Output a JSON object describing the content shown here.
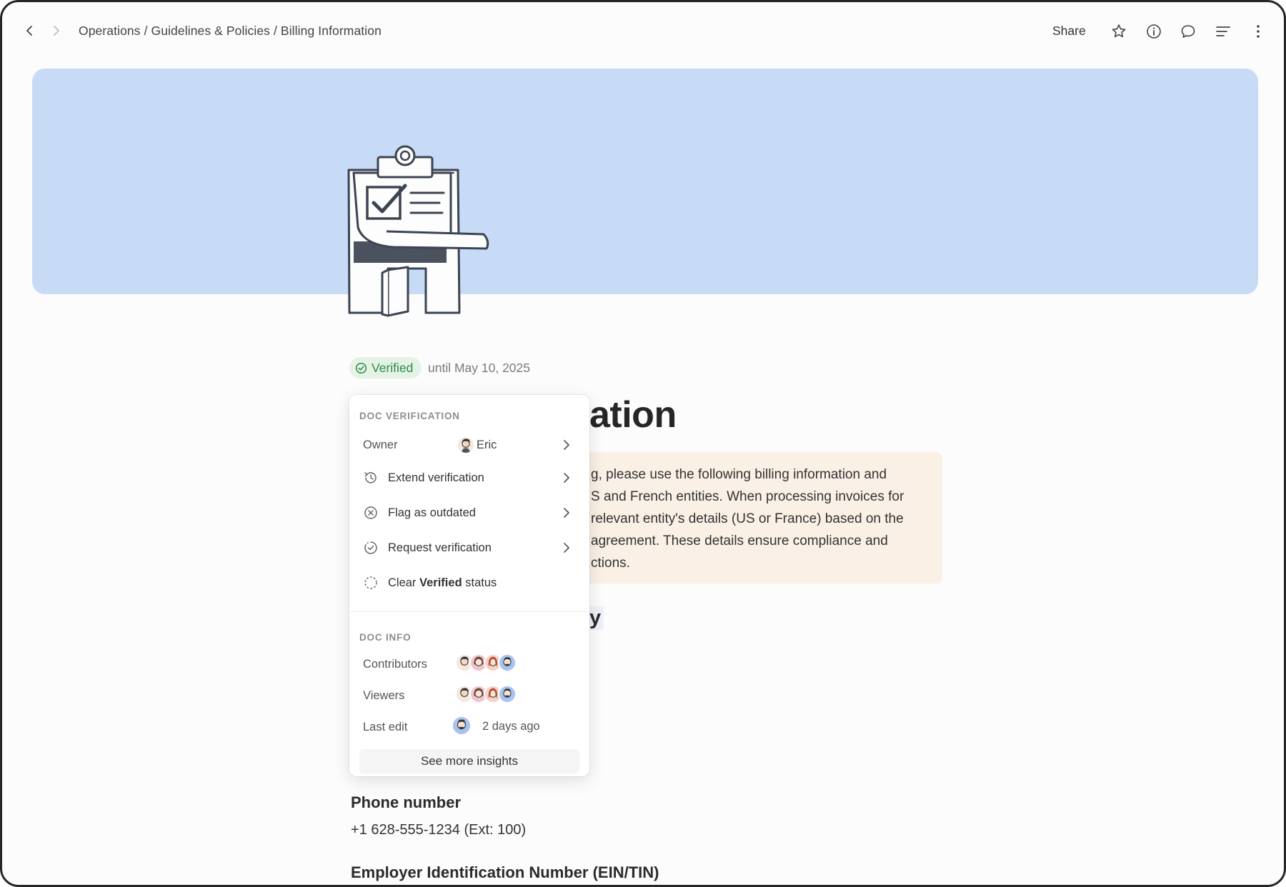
{
  "breadcrumb": {
    "items": [
      "Operations",
      "Guidelines & Policies",
      "Billing Information"
    ],
    "separator": "/"
  },
  "toolbar": {
    "share_label": "Share",
    "icons": [
      "star-icon",
      "info-icon",
      "comment-icon",
      "outline-icon",
      "more-icon"
    ]
  },
  "banner": {
    "color": "#c8dbf6",
    "illustration": "clipboard-checklist-illustration"
  },
  "verification": {
    "badge_label": "Verified",
    "until_text": "until May 10, 2025",
    "badge_color": "#2f8a45"
  },
  "doc": {
    "title_visible": "ation",
    "callout_lines": [
      "g, please use the following billing information and",
      "S and French entities. When processing invoices for",
      "relevant entity's details (US or France) based on the",
      "agreement. These details ensure compliance and",
      "ctions."
    ],
    "section_heading_visible": "y",
    "fields": [
      {
        "label": "Phone number",
        "value": "+1 628-555-1234 (Ext: 100)"
      },
      {
        "label": "Employer Identification Number (EIN/TIN)",
        "value": ""
      }
    ]
  },
  "popover": {
    "verification_title": "DOC VERIFICATION",
    "owner_label": "Owner",
    "owner_name": "Eric",
    "actions": [
      {
        "label": "Extend verification",
        "icon": "clock-refresh-icon",
        "has_submenu": true
      },
      {
        "label": "Flag as outdated",
        "icon": "x-circle-icon",
        "has_submenu": true
      },
      {
        "label": "Request verification",
        "icon": "check-circle-dashed-icon",
        "has_submenu": true
      }
    ],
    "clear_prefix": "Clear",
    "clear_bold": "Verified",
    "clear_suffix": "status",
    "info_title": "DOC INFO",
    "contributors_label": "Contributors",
    "viewers_label": "Viewers",
    "last_edit_label": "Last edit",
    "last_edit_value": "2 days ago",
    "insights_button": "See more insights"
  }
}
